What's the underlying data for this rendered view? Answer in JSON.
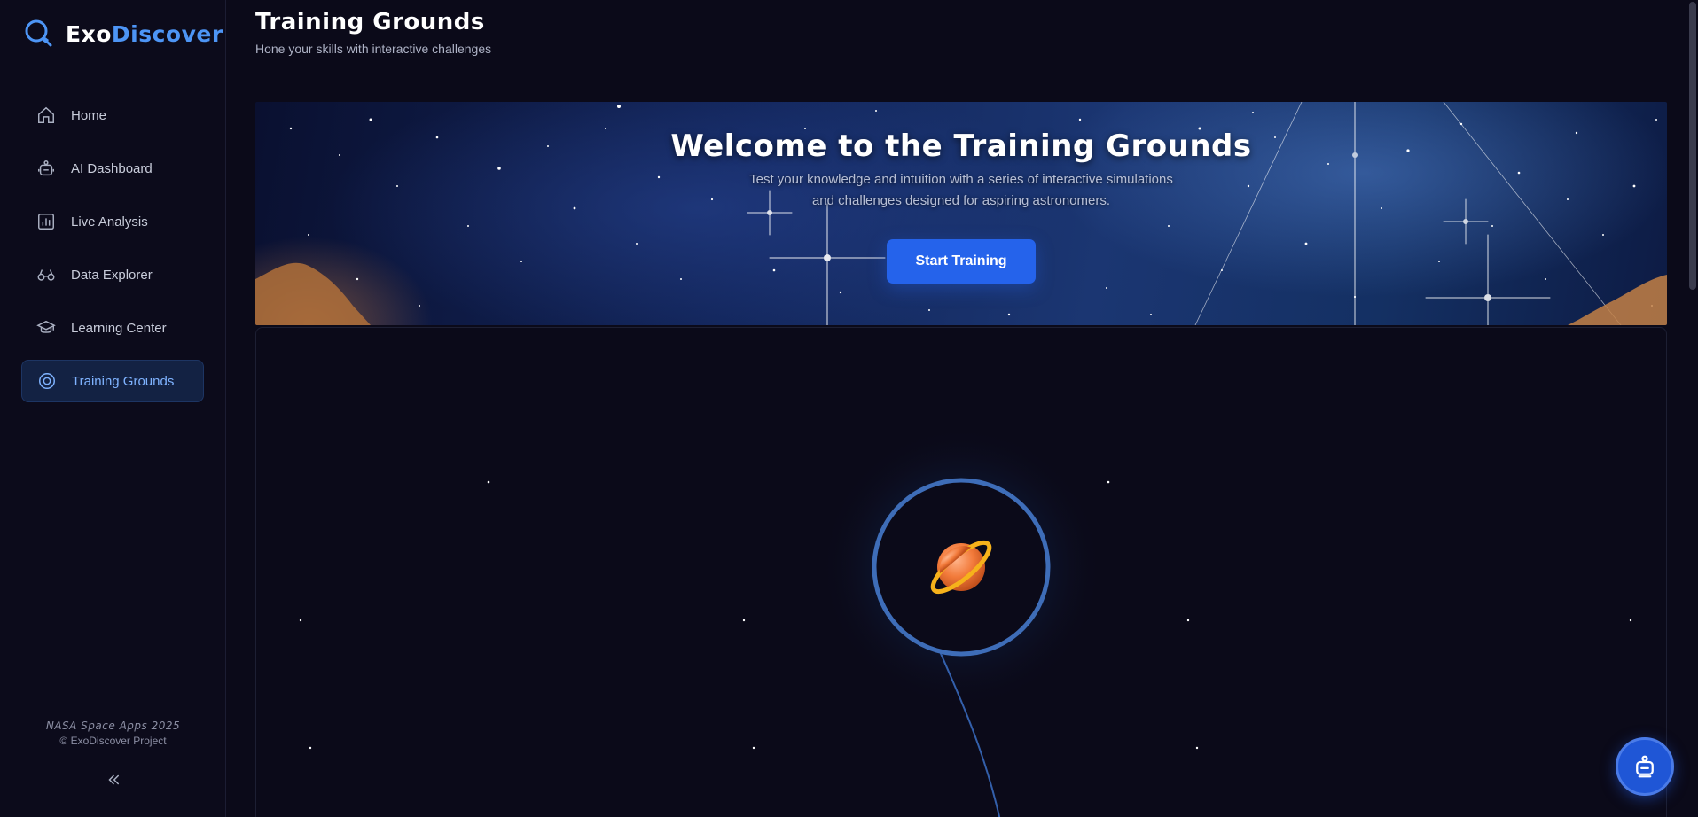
{
  "brand": {
    "part1": "Exo",
    "part2": "Discover"
  },
  "sidebar": {
    "items": [
      {
        "label": "Home",
        "icon": "home-icon"
      },
      {
        "label": "AI Dashboard",
        "icon": "robot-icon"
      },
      {
        "label": "Live Analysis",
        "icon": "bar-chart-icon"
      },
      {
        "label": "Data Explorer",
        "icon": "binoculars-icon"
      },
      {
        "label": "Learning Center",
        "icon": "graduation-cap-icon"
      },
      {
        "label": "Training Grounds",
        "icon": "target-icon",
        "active": true
      }
    ],
    "footer_line1": "NASA Space Apps 2025",
    "footer_line2": "© ExoDiscover Project"
  },
  "header": {
    "title": "Training Grounds",
    "subtitle": "Hone your skills with interactive challenges"
  },
  "hero": {
    "title": "Welcome to the Training Grounds",
    "description": "Test your knowledge and intuition with a series of interactive simulations and challenges designed for aspiring astronomers.",
    "button_label": "Start Training"
  },
  "colors": {
    "accent": "#2563eb",
    "brand_blue": "#4d95f5",
    "active_nav_bg": "#132243",
    "background": "#0b0a19"
  }
}
